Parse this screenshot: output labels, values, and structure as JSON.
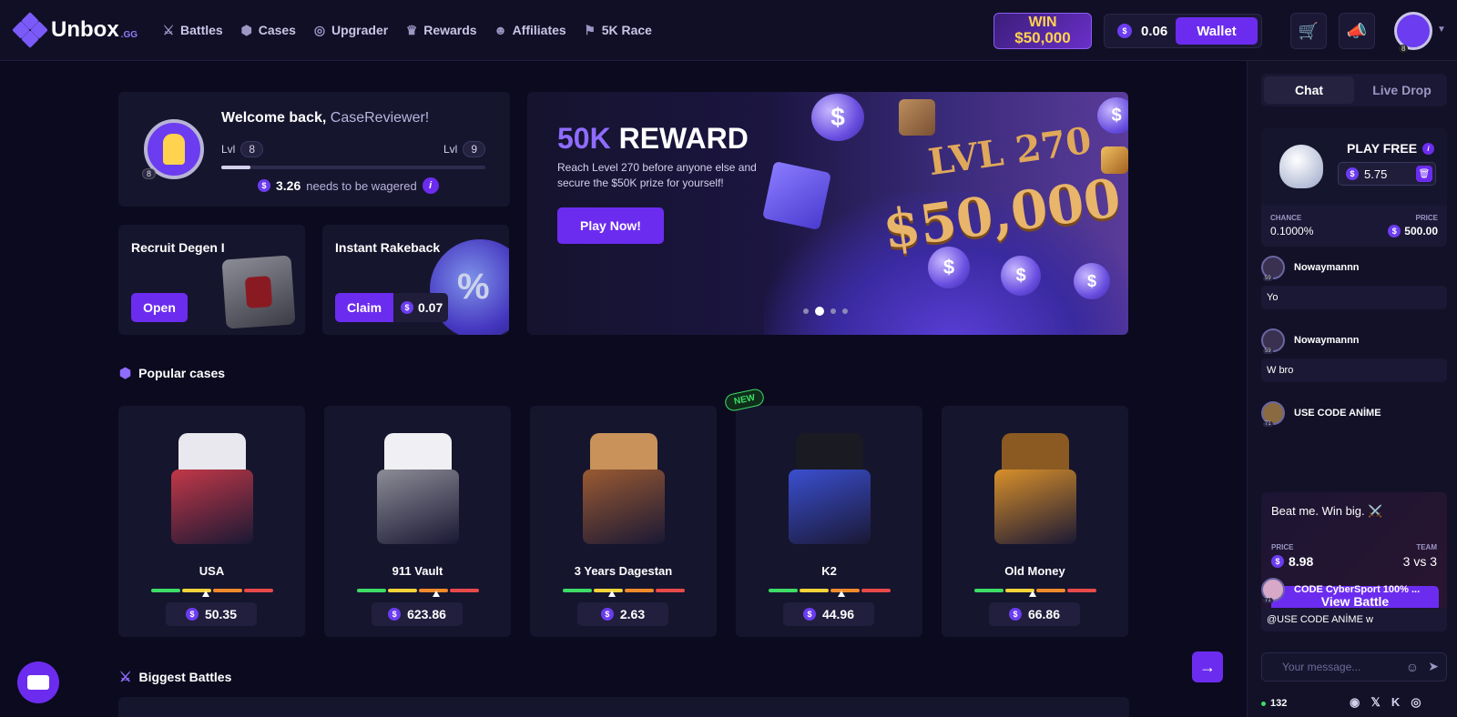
{
  "header": {
    "logo_name": "Unbox",
    "logo_suffix": ".GG",
    "nav": [
      {
        "label": "Battles",
        "icon": "swords-icon"
      },
      {
        "label": "Cases",
        "icon": "box-icon"
      },
      {
        "label": "Upgrader",
        "icon": "upgrade-icon"
      },
      {
        "label": "Rewards",
        "icon": "trophy-icon"
      },
      {
        "label": "Affiliates",
        "icon": "users-icon"
      },
      {
        "label": "5K Race",
        "icon": "flags-icon"
      }
    ],
    "win_line1": "WIN",
    "win_line2": "$50,000",
    "balance": "0.06",
    "wallet_label": "Wallet",
    "avatar_level": "8"
  },
  "welcome": {
    "greeting": "Welcome back, ",
    "username": "CaseReviewer!",
    "lvl_label": "Lvl",
    "current_level": "8",
    "next_level": "9",
    "progress": 0.11,
    "wager_amount": "3.26",
    "wager_text": "needs to be wagered",
    "avatar_level": "8"
  },
  "recruit": {
    "title": "Recruit Degen I",
    "button": "Open"
  },
  "rakeback": {
    "title": "Instant Rakeback",
    "button": "Claim",
    "amount": "0.07"
  },
  "banner": {
    "title_highlight": "50K",
    "title_rest": " REWARD",
    "subtitle": "Reach Level 270 before anyone else and secure the $50K prize for yourself!",
    "button": "Play Now!",
    "prize_level": "LVL 270",
    "prize_amount": "$50,000",
    "slide_count": 4,
    "active_slide": 2
  },
  "popular": {
    "title": "Popular cases",
    "new_tag": "NEW",
    "cases": [
      {
        "name": "USA",
        "price": "50.35",
        "color": "#c23848",
        "top": "#e8e8ee",
        "tick": 0.45
      },
      {
        "name": "911 Vault",
        "price": "623.86",
        "color": "#8c8c96",
        "top": "#f0f0f4",
        "tick": 0.65
      },
      {
        "name": "3 Years Dagestan",
        "price": "2.63",
        "color": "#9a5a32",
        "top": "#c8925a",
        "tick": 0.4
      },
      {
        "name": "K2",
        "price": "44.96",
        "color": "#3a4fd0",
        "top": "#1a1a22",
        "tick": 0.6
      },
      {
        "name": "Old Money",
        "price": "66.86",
        "color": "#d8902a",
        "top": "#8a5a22",
        "tick": 0.48
      }
    ]
  },
  "battles": {
    "title": "Biggest Battles"
  },
  "sidebar": {
    "tab_chat": "Chat",
    "tab_live": "Live Drop",
    "play_free": "PLAY FREE",
    "free_value": "5.75",
    "chance_label": "CHANCE",
    "chance_value": "0.1000%",
    "price_label": "PRICE",
    "price_value": "500.00",
    "messages": [
      {
        "user": "Nowaymannn",
        "text": "Yo",
        "level": "59"
      },
      {
        "user": "Nowaymannn",
        "text": "W bro",
        "level": "59"
      },
      {
        "user": "USE CODE ANİME",
        "level": "71"
      },
      {
        "user": "CODE CyberSport 100% ...",
        "text": "@USE CODE ANİME w",
        "level": "71"
      }
    ],
    "battle": {
      "text": "Beat me. Win big. ⚔️",
      "price_label": "PRICE",
      "price": "8.98",
      "team_label": "TEAM",
      "team": "3 vs 3",
      "button": "View Battle"
    },
    "input_placeholder": "Your message...",
    "online_count": "132"
  }
}
